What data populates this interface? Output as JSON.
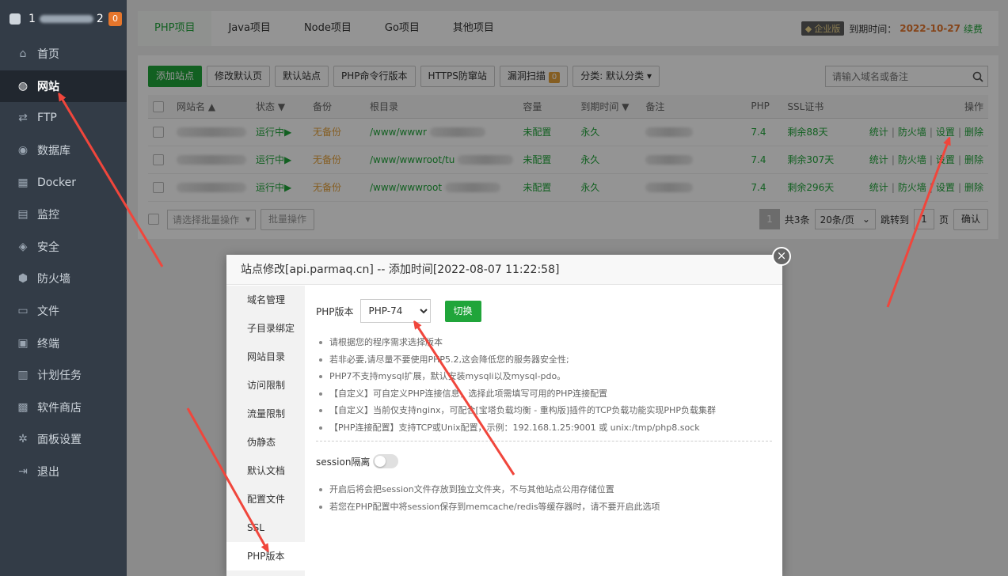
{
  "sidebar": {
    "brand_name": "1",
    "brand_suffix": "2",
    "badge": "0",
    "items": [
      {
        "label": "首页",
        "icon": "home-icon"
      },
      {
        "label": "网站",
        "icon": "globe-icon",
        "active": true
      },
      {
        "label": "FTP",
        "icon": "ftp-icon"
      },
      {
        "label": "数据库",
        "icon": "database-icon"
      },
      {
        "label": "Docker",
        "icon": "docker-icon"
      },
      {
        "label": "监控",
        "icon": "monitor-icon"
      },
      {
        "label": "安全",
        "icon": "shield-icon"
      },
      {
        "label": "防火墙",
        "icon": "firewall-icon"
      },
      {
        "label": "文件",
        "icon": "folder-icon"
      },
      {
        "label": "终端",
        "icon": "terminal-icon"
      },
      {
        "label": "计划任务",
        "icon": "calendar-icon"
      },
      {
        "label": "软件商店",
        "icon": "apps-icon"
      },
      {
        "label": "面板设置",
        "icon": "gear-icon"
      },
      {
        "label": "退出",
        "icon": "logout-icon"
      }
    ]
  },
  "topbar": {
    "tabs": [
      "PHP项目",
      "Java项目",
      "Node项目",
      "Go项目",
      "其他项目"
    ],
    "vip_label": "企业版",
    "expire_label": "到期时间：",
    "expire_date": "2022-10-27",
    "renew": "续费"
  },
  "toolbar": {
    "add_site": "添加站点",
    "edit_default_page": "修改默认页",
    "default_site": "默认站点",
    "php_cli": "PHP命令行版本",
    "https_waf": "HTTPS防窜站",
    "vuln_scan": "漏洞扫描",
    "vuln_count": "0",
    "category": "分类: 默认分类",
    "search_placeholder": "请输入域名或备注"
  },
  "table": {
    "headers": {
      "name": "网站名 ▲",
      "status": "状态 ▼",
      "backup": "备份",
      "root": "根目录",
      "quota": "容量",
      "expire": "到期时间 ▼",
      "remark": "备注",
      "php": "PHP",
      "ssl": "SSL证书",
      "ops": "操作"
    },
    "rows": [
      {
        "status": "运行中▶",
        "backup": "无备份",
        "root": "/www/wwwr",
        "quota": "未配置",
        "expire": "永久",
        "php": "7.4",
        "ssl": "剩余88天"
      },
      {
        "status": "运行中▶",
        "backup": "无备份",
        "root": "/www/wwwroot/tu",
        "quota": "未配置",
        "expire": "永久",
        "php": "7.4",
        "ssl": "剩余307天"
      },
      {
        "status": "运行中▶",
        "backup": "无备份",
        "root": "/www/wwwroot",
        "quota": "未配置",
        "expire": "永久",
        "php": "7.4",
        "ssl": "剩余296天"
      }
    ],
    "ops": {
      "stats": "统计",
      "firewall": "防火墙",
      "settings": "设置",
      "delete": "删除"
    }
  },
  "footer": {
    "batch_placeholder": "请选择批量操作",
    "batch_btn": "批量操作",
    "page": "1",
    "total": "共3条",
    "per_page": "20条/页",
    "jump_label": "跳转到",
    "jump_value": "1",
    "page_unit": "页",
    "confirm": "确认"
  },
  "modal": {
    "title": "站点修改[api.parmaq.cn] -- 添加时间[2022-08-07 11:22:58]",
    "close": "×",
    "menu": [
      "域名管理",
      "子目录绑定",
      "网站目录",
      "访问限制",
      "流量限制",
      "伪静态",
      "默认文档",
      "配置文件",
      "SSL",
      "PHP版本"
    ],
    "php_label": "PHP版本",
    "php_selected": "PHP-74",
    "switch_btn": "切换",
    "tips": [
      "请根据您的程序需求选择版本",
      "若非必要,请尽量不要使用PHP5.2,这会降低您的服务器安全性;",
      "PHP7不支持mysql扩展，默认安装mysqli以及mysql-pdo。",
      "【自定义】可自定义PHP连接信息，选择此项需填写可用的PHP连接配置",
      "【自定义】当前仅支持nginx，可配合[宝塔负载均衡 - 重构版]插件的TCP负载功能实现PHP负载集群",
      "【PHP连接配置】支持TCP或Unix配置，示例：192.168.1.25:9001 或 unix:/tmp/php8.sock"
    ],
    "session_label": "session隔离",
    "session_tips": [
      "开启后将会把session文件存放到独立文件夹，不与其他站点公用存储位置",
      "若您在PHP配置中将session保存到memcache/redis等缓存器时，请不要开启此选项"
    ]
  },
  "colors": {
    "accent": "#20a53a",
    "warning": "#e6a23c",
    "sidebar": "#333c47",
    "arrow": "#f0463c"
  }
}
